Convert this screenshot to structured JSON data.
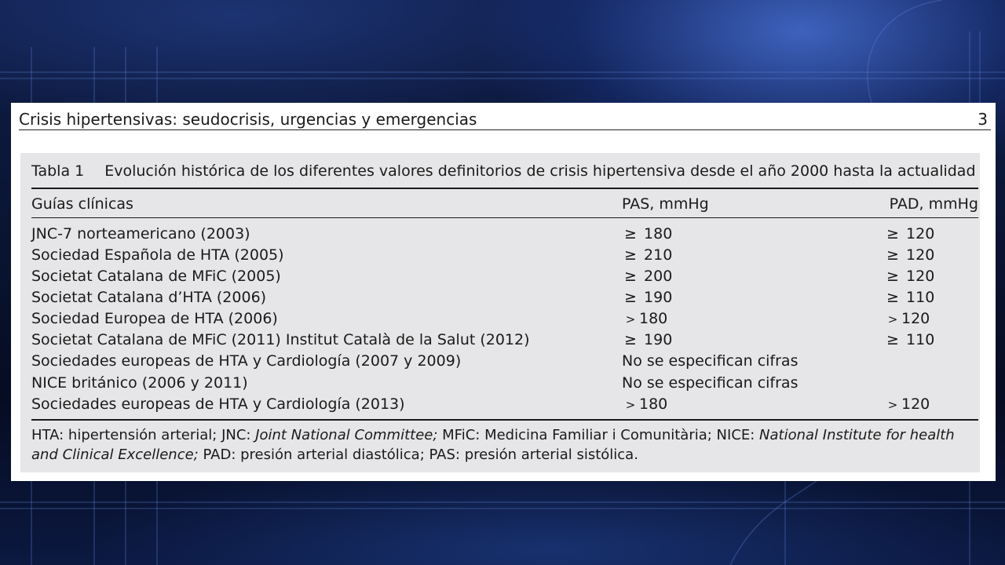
{
  "running_head": {
    "title": "Crisis hipertensivas: seudocrisis, urgencias y emergencias",
    "page_number": "3"
  },
  "table": {
    "label": "Tabla 1",
    "caption": "Evolución histórica de los diferentes valores definitorios de crisis hipertensiva desde el año 2000 hasta la actualidad",
    "headers": [
      "Guías clínicas",
      "PAS, mmHg",
      "PAD, mmHg"
    ],
    "rows": [
      {
        "guide": "JNC-7 norteamericano (2003)",
        "pas_op": "≥",
        "pas": "180",
        "pad_op": "≥",
        "pad": "120"
      },
      {
        "guide": "Sociedad Española de HTA (2005)",
        "pas_op": "≥",
        "pas": "210",
        "pad_op": "≥",
        "pad": "120"
      },
      {
        "guide": "Societat Catalana de MFiC (2005)",
        "pas_op": "≥",
        "pas": "200",
        "pad_op": "≥",
        "pad": "120"
      },
      {
        "guide": "Societat Catalana d’HTA (2006)",
        "pas_op": "≥",
        "pas": "190",
        "pad_op": "≥",
        "pad": "110"
      },
      {
        "guide": "Sociedad Europea de HTA (2006)",
        "pas_op": ">",
        "pas": "180",
        "pad_op": ">",
        "pad": "120"
      },
      {
        "guide": "Societat Catalana de MFiC (2011) Institut Català de la Salut (2012)",
        "pas_op": "≥",
        "pas": "190",
        "pad_op": "≥",
        "pad": "110"
      },
      {
        "guide": "Sociedades europeas de HTA y Cardiología (2007 y 2009)",
        "span": "No se especifican cifras"
      },
      {
        "guide": "NICE británico (2006 y 2011)",
        "span": "No se especifican cifras"
      },
      {
        "guide": "Sociedades europeas de HTA y Cardiología (2013)",
        "pas_op": ">",
        "pas": "180",
        "pad_op": ">",
        "pad": "120"
      }
    ],
    "footnote": {
      "p1": "HTA: hipertensión arterial; JNC: ",
      "i1": "Joint National Committee;",
      "p2": " MFiC: Medicina Familiar i Comunitària; NICE: ",
      "i2": "National Institute for health and Clinical Excellence;",
      "p3": " PAD: presión arterial diastólica; PAS: presión arterial sistólica."
    }
  }
}
